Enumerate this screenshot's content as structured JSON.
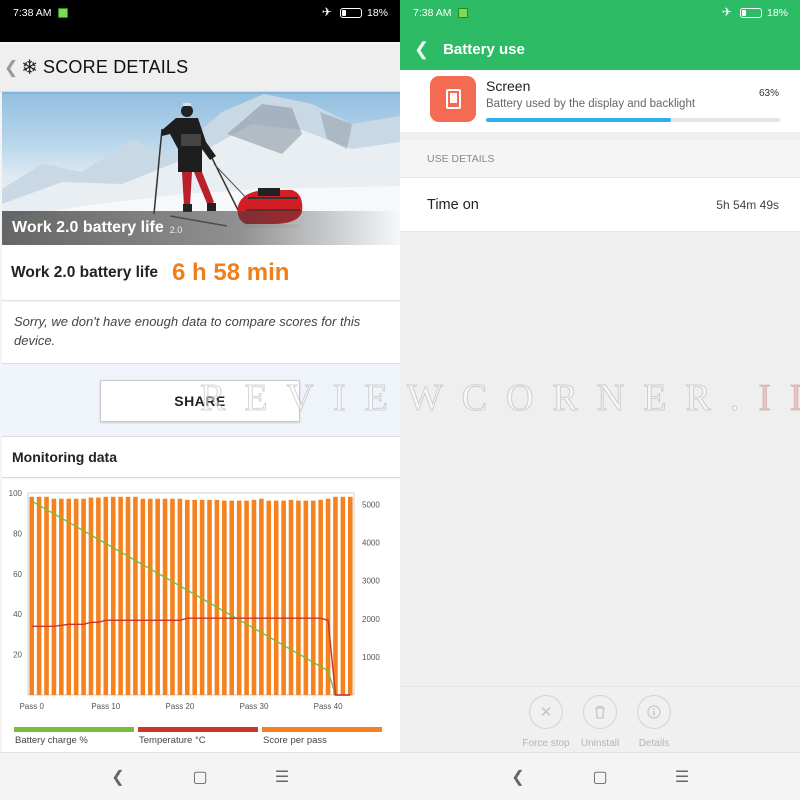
{
  "left": {
    "status": {
      "time": "7:38 AM",
      "battery_pct": "18%"
    },
    "header": {
      "title": "SCORE DETAILS"
    },
    "hero": {
      "name": "Work 2.0 battery life",
      "version": "2.0"
    },
    "result": {
      "label": "Work 2.0 battery life",
      "value": "6 h 58 min"
    },
    "note": "Sorry, we don't have enough data to compare scores for this device.",
    "share_label": "SHARE",
    "monitoring_title": "Monitoring data"
  },
  "right": {
    "status": {
      "time": "7:38 AM",
      "battery_pct": "18%"
    },
    "header": {
      "title": "Battery use"
    },
    "screen": {
      "name": "Screen",
      "desc": "Battery used by the display and backlight",
      "pct": "63%",
      "progress": 0.63
    },
    "use_details_label": "USE DETAILS",
    "time_on": {
      "label": "Time on",
      "value": "5h 54m 49s"
    },
    "actions": [
      {
        "label": "Force stop",
        "icon": "close-icon"
      },
      {
        "label": "Uninstall",
        "icon": "trash-icon"
      },
      {
        "label": "Details",
        "icon": "info-icon"
      }
    ]
  },
  "colors": {
    "green_header": "#2dbb66",
    "orange": "#f07f1b",
    "accent_blue": "#2eaeea",
    "screen_icon": "#f46a52"
  },
  "watermark": {
    "text": "REVIEWCORNER.",
    "highlight": "ID"
  },
  "chart_data": {
    "type": "bar",
    "x_ticks": [
      "Pass 0",
      "Pass 10",
      "Pass 20",
      "Pass 30",
      "Pass 40"
    ],
    "x_range": [
      0,
      43
    ],
    "y_left": {
      "ticks": [
        20,
        40,
        60,
        80,
        100
      ],
      "range": [
        0,
        100
      ]
    },
    "y_right": {
      "ticks": [
        1000,
        2000,
        3000,
        4000,
        5000
      ],
      "range": [
        0,
        5300
      ]
    },
    "legend": [
      "Battery charge %",
      "Temperature °C",
      "Score per pass"
    ],
    "series": [
      {
        "name": "Score per pass",
        "kind": "bar",
        "axis": "right",
        "color": "#f5821f",
        "values": [
          5200,
          5200,
          5200,
          5150,
          5150,
          5150,
          5150,
          5150,
          5180,
          5180,
          5200,
          5200,
          5200,
          5200,
          5200,
          5150,
          5150,
          5150,
          5150,
          5150,
          5150,
          5120,
          5120,
          5120,
          5120,
          5120,
          5100,
          5100,
          5100,
          5100,
          5120,
          5150,
          5100,
          5100,
          5100,
          5120,
          5100,
          5100,
          5100,
          5120,
          5150,
          5200,
          5200,
          5200
        ]
      },
      {
        "name": "Battery charge %",
        "kind": "line",
        "axis": "left",
        "color": "#78be3c",
        "values": [
          96,
          93.9,
          91.8,
          89.7,
          87.6,
          85.5,
          83.4,
          81.3,
          79.2,
          77.1,
          75,
          72.9,
          70.8,
          68.7,
          66.6,
          64.5,
          62.4,
          60.3,
          58.2,
          56.1,
          54,
          51.9,
          49.8,
          47.7,
          45.6,
          43.5,
          41.4,
          39.3,
          37.2,
          35.1,
          33,
          30.9,
          28.8,
          26.7,
          24.6,
          22.5,
          20.4,
          18.3,
          16.2,
          14.1,
          12,
          0,
          0,
          0
        ]
      },
      {
        "name": "Temperature °C",
        "kind": "line",
        "axis": "left",
        "color": "#c8362d",
        "values": [
          34,
          34,
          34,
          34,
          34.5,
          35,
          35,
          35,
          36,
          36,
          37,
          37,
          37,
          37,
          37,
          37,
          37,
          37,
          37,
          37,
          37,
          38,
          38,
          38,
          38,
          38,
          38,
          38,
          38,
          38,
          38,
          38,
          38,
          38,
          38,
          38,
          38,
          38,
          38,
          38,
          37,
          0,
          0,
          0
        ]
      }
    ]
  }
}
